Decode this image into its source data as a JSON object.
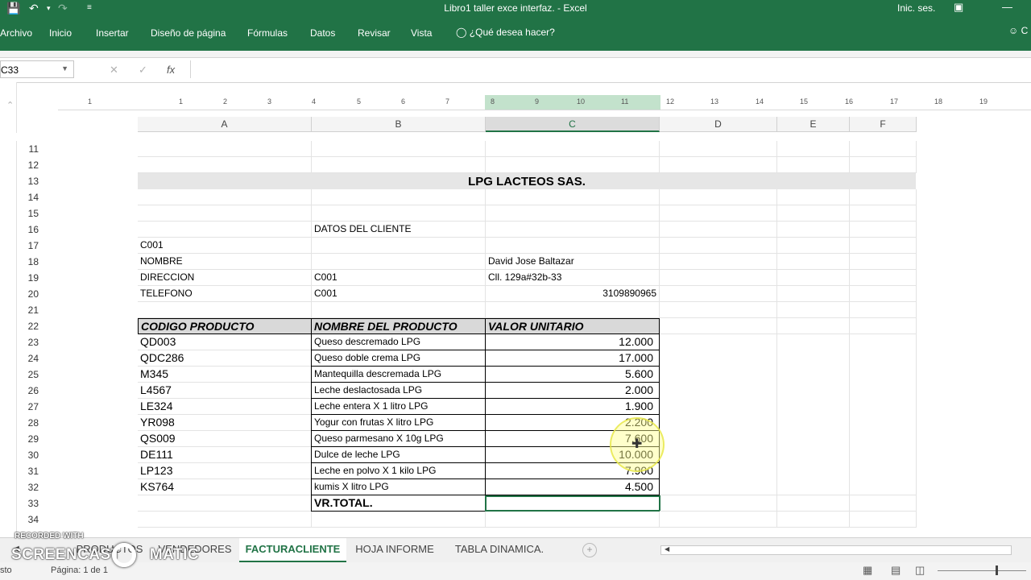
{
  "window": {
    "title": "Libro1 taller exce interfaz. - Excel",
    "sign_in": "Inic. ses.",
    "icons": {
      "save": "save-icon",
      "undo": "undo-icon",
      "redo": "redo-icon",
      "customize": "customize-qat-icon"
    }
  },
  "ribbon": {
    "tabs": [
      "Archivo",
      "Inicio",
      "Insertar",
      "Diseño de página",
      "Fórmulas",
      "Datos",
      "Revisar",
      "Vista"
    ],
    "tell_me": "¿Qué desea hacer?",
    "user_initial": "C"
  },
  "formula_bar": {
    "name_box": "C33",
    "fx": "fx",
    "value": ""
  },
  "ruler": {
    "ticks": [
      "1",
      "1",
      "2",
      "3",
      "4",
      "5",
      "6",
      "7",
      "8",
      "9",
      "10",
      "11",
      "12",
      "13",
      "14",
      "15",
      "16",
      "17",
      "18",
      "19"
    ]
  },
  "columns": [
    {
      "letter": "A"
    },
    {
      "letter": "B"
    },
    {
      "letter": "C",
      "selected": true
    },
    {
      "letter": "D"
    },
    {
      "letter": "E"
    },
    {
      "letter": "F"
    }
  ],
  "rows": [
    "11",
    "12",
    "13",
    "14",
    "15",
    "16",
    "17",
    "18",
    "19",
    "20",
    "21",
    "22",
    "23",
    "24",
    "25",
    "26",
    "27",
    "28",
    "29",
    "30",
    "31",
    "32",
    "33",
    "34"
  ],
  "sheet": {
    "company": "LPG LACTEOS SAS.",
    "client_section": "DATOS DEL CLIENTE",
    "client_code": "C001",
    "name_label": "NOMBRE",
    "name_value": "David Jose  Baltazar",
    "address_label": "DIRECCION",
    "address_ref": "C001",
    "address_value": "Cll. 129a#32b-33",
    "phone_label": "TELEFONO",
    "phone_ref": "C001",
    "phone_value": "3109890965",
    "headers": [
      "CODIGO PRODUCTO",
      "NOMBRE DEL PRODUCTO",
      "VALOR UNITARIO"
    ],
    "products": [
      {
        "code": "QD003",
        "name": "Queso descremado LPG",
        "price": "12.000"
      },
      {
        "code": "QDC286",
        "name": "Queso doble crema LPG",
        "price": "17.000"
      },
      {
        "code": "M345",
        "name": "Mantequilla descremada LPG",
        "price": "5.600"
      },
      {
        "code": "L4567",
        "name": "Leche deslactosada LPG",
        "price": "2.000"
      },
      {
        "code": "LE324",
        "name": "Leche entera X 1 litro LPG",
        "price": "1.900"
      },
      {
        "code": "YR098",
        "name": "Yogur con frutas X litro LPG",
        "price": "2.200"
      },
      {
        "code": "QS009",
        "name": "Queso parmesano X 10g LPG",
        "price": "7.600"
      },
      {
        "code": "DE111",
        "name": "Dulce de leche LPG",
        "price": "10.000"
      },
      {
        "code": "LP123",
        "name": "Leche en polvo X 1 kilo LPG",
        "price": "7.900"
      },
      {
        "code": "KS764",
        "name": "kumis X litro LPG",
        "price": "4.500"
      }
    ],
    "total_label": "VR.TOTAL.",
    "total_value": ""
  },
  "sheet_tabs": {
    "tabs": [
      "PRODUCTOS",
      "VENDEDORES",
      "FACTURACLIENTE",
      "HOJA INFORME",
      "TABLA DINAMICA."
    ],
    "active": "FACTURACLIENTE"
  },
  "status_bar": {
    "status": "sto",
    "page": "Página: 1 de 1"
  },
  "watermark": {
    "recorded_with": "RECORDED WITH",
    "brand_left": "SCREENCAST",
    "brand_right": "MATIC"
  }
}
